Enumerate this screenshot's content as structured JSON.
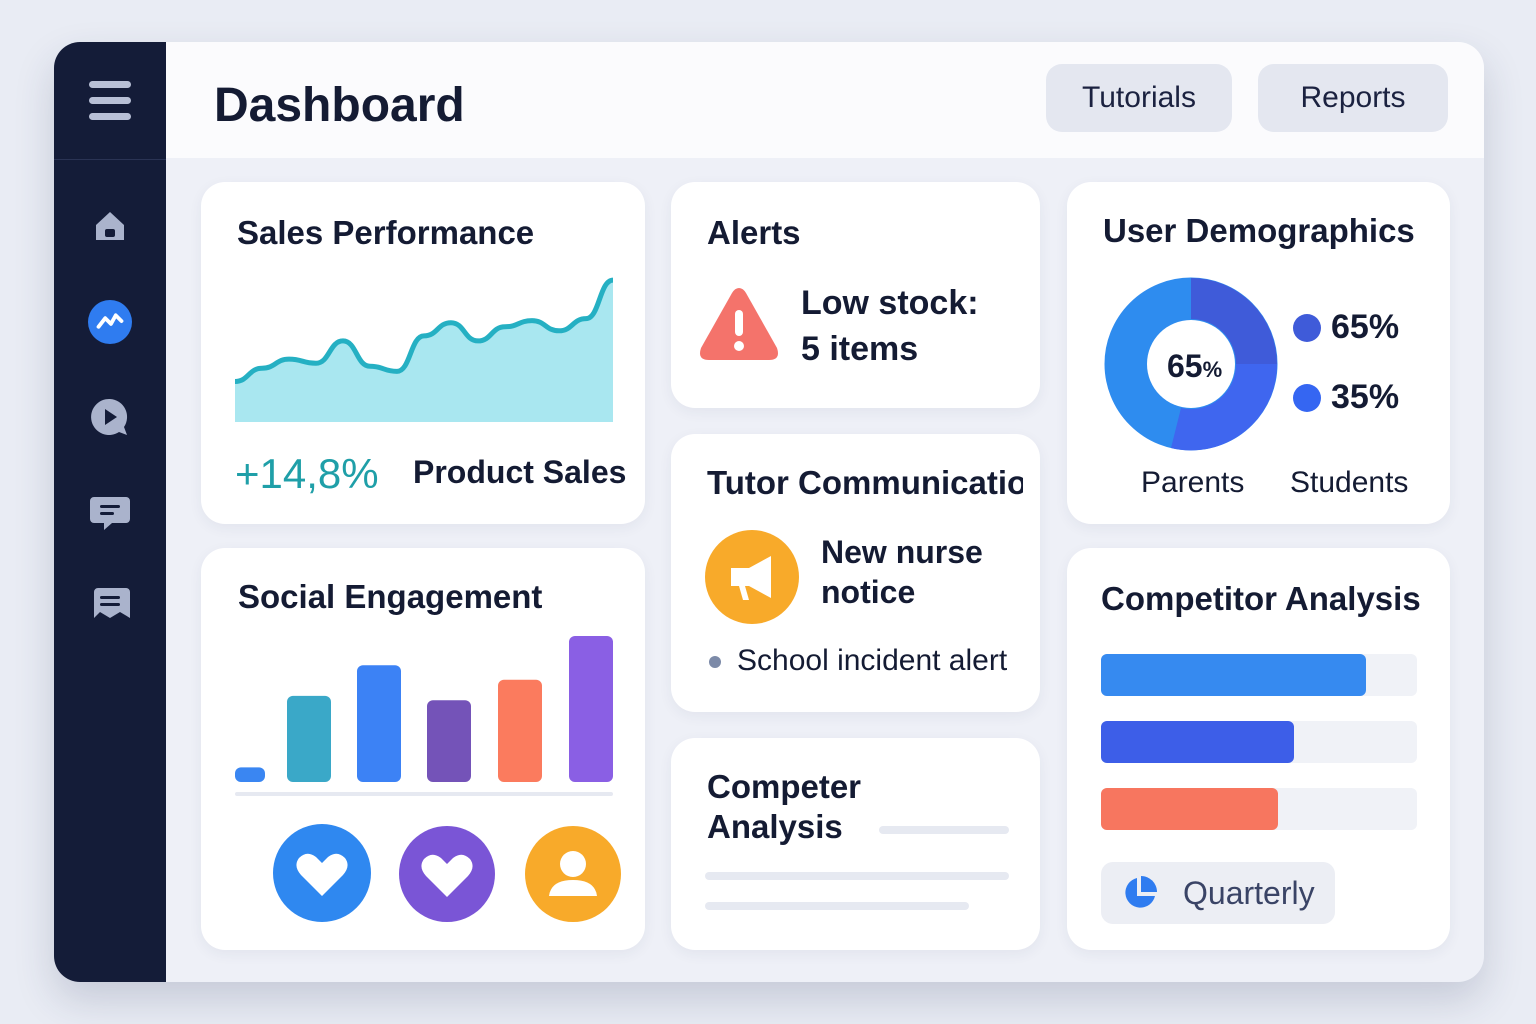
{
  "header": {
    "title": "Dashboard",
    "buttons": [
      "Tutorials",
      "Reports"
    ]
  },
  "sidebar": {
    "menu_icon": "hamburger-icon",
    "items": [
      {
        "icon": "home-icon",
        "active": false
      },
      {
        "icon": "trend-icon",
        "active": true
      },
      {
        "icon": "play-chat-icon",
        "active": false
      },
      {
        "icon": "chat-icon",
        "active": false
      },
      {
        "icon": "message-icon",
        "active": false
      }
    ]
  },
  "colors": {
    "sidebar": "#141c38",
    "accent": "#2f7cf0",
    "teal": "#25aab4",
    "alert": "#f4736b",
    "orange": "#f8aa2a"
  },
  "sales": {
    "title": "Sales Performance",
    "change": "+14,8%",
    "label": "Product Sales",
    "chart_data": {
      "type": "area",
      "values": [
        40,
        53,
        62,
        58,
        80,
        55,
        50,
        85,
        98,
        80,
        94,
        100,
        90,
        102,
        140
      ]
    }
  },
  "alerts": {
    "title": "Alerts",
    "line1": "Low stock:",
    "line2": "5 items",
    "icon": "warning-icon"
  },
  "tutor": {
    "title": "Tutor Communicatio",
    "notice_line1": "New nurse",
    "notice_line2": "notice",
    "bullet": "School incident alert",
    "icon": "megaphone-icon"
  },
  "demographics": {
    "title": "User Demographics",
    "center": "65",
    "center_unit": "%",
    "legend": [
      {
        "value": "65%",
        "color": "#3f5bd9"
      },
      {
        "value": "35%",
        "color": "#3566f2"
      }
    ],
    "labels": [
      "Parents",
      "Students"
    ],
    "chart_data": {
      "type": "pie",
      "values": [
        65,
        35
      ]
    }
  },
  "social": {
    "title": "Social Engagement",
    "chart_data": {
      "type": "bar",
      "values": [
        1,
        5.9,
        8,
        5.6,
        7,
        10
      ],
      "colors": [
        "#3a86f2",
        "#3aa8c8",
        "#3c82f5",
        "#7453b8",
        "#fb7b5e",
        "#8a5fe4"
      ]
    },
    "icons": [
      {
        "name": "heart-icon",
        "color": "#2f88f0"
      },
      {
        "name": "heart-icon",
        "color": "#7a55d6"
      },
      {
        "name": "user-icon",
        "color": "#f8aa2a"
      }
    ]
  },
  "competer": {
    "title_line1": "Competer",
    "title_line2": "Analysis"
  },
  "competitor": {
    "title": "Competitor Analysis",
    "chart_data": {
      "type": "bar",
      "values": [
        0.84,
        0.61,
        0.56
      ],
      "colors": [
        "#368af0",
        "#3d5ee8",
        "#f7765f"
      ]
    },
    "button": "Quarterly",
    "button_icon": "pie-chart-icon"
  }
}
